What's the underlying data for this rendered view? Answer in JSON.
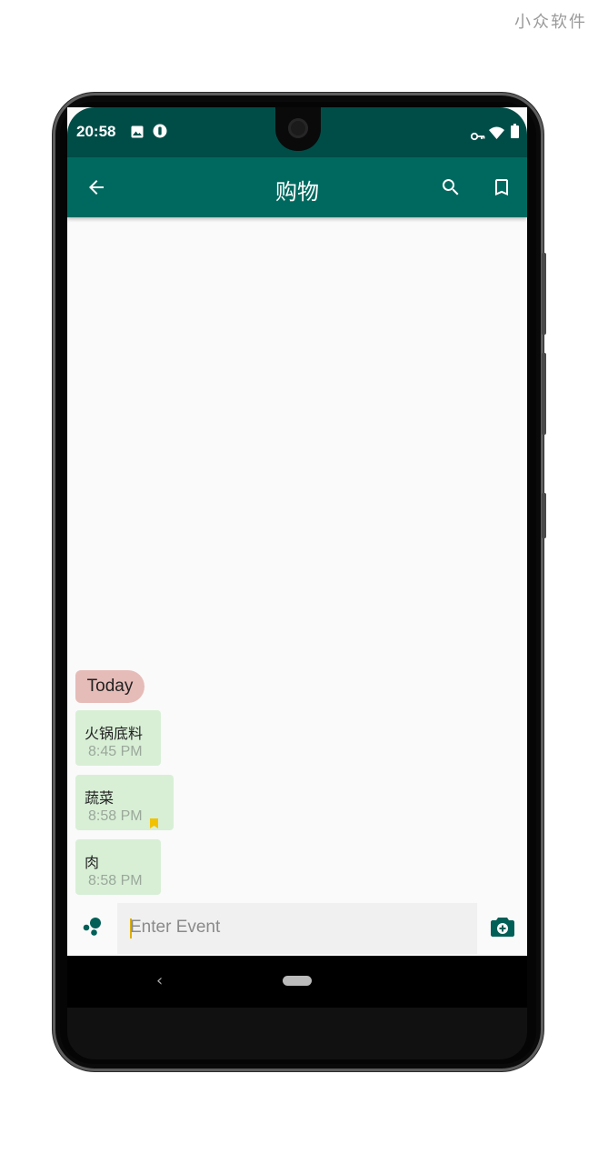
{
  "watermark": "小众软件",
  "status_bar": {
    "time": "20:58",
    "icons": [
      "image-icon",
      "info-icon",
      "vpn-key-icon",
      "wifi-icon",
      "battery-icon"
    ]
  },
  "app_bar": {
    "title": "购物",
    "icons": [
      "back-arrow-icon",
      "search-icon",
      "bookmark-icon"
    ],
    "color": "#00695f",
    "status_color": "#004d48"
  },
  "chat": {
    "date_label": "Today",
    "messages": [
      {
        "text": "火锅底料",
        "time": "8:45 PM",
        "starred": false
      },
      {
        "text": "蔬菜",
        "time": "8:58 PM",
        "starred": true
      },
      {
        "text": "肉",
        "time": "8:58 PM",
        "starred": false
      }
    ],
    "bubble_color": "#d8efd6",
    "date_chip_color": "#e6bcb8",
    "star_color": "#f2c200"
  },
  "input": {
    "placeholder": "Enter Event",
    "left_icon": "categories-icon",
    "right_icon": "add-photo-icon"
  },
  "nav_bar": {
    "icons": [
      "nav-back-icon",
      "nav-home-icon"
    ],
    "back_glyph": "‹"
  }
}
